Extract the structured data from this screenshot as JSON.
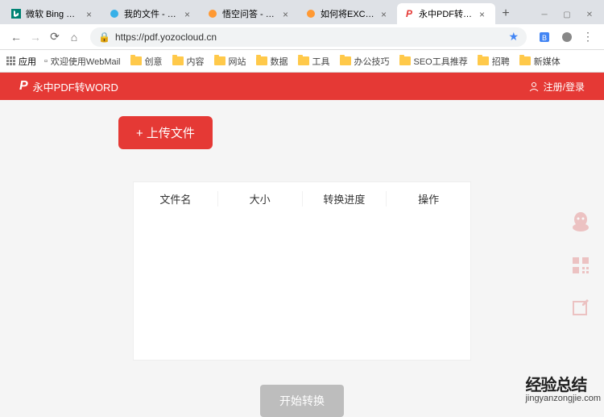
{
  "browser": {
    "tabs": [
      {
        "title": "微软 Bing 搜索 - 国",
        "icon": "bing"
      },
      {
        "title": "我的文件 - 优云",
        "icon": "cloud"
      },
      {
        "title": "悟空问答 - 搜索",
        "icon": "wukong"
      },
      {
        "title": "如何将EXCEL转换",
        "icon": "wukong"
      },
      {
        "title": "永中PDF转Word",
        "icon": "yozo",
        "active": true
      }
    ],
    "url": "https://pdf.yozocloud.cn",
    "apps_label": "应用",
    "bookmarks": [
      "欢迎使用WebMail",
      "创意",
      "内容",
      "网站",
      "数据",
      "工具",
      "办公技巧",
      "SEO工具推荐",
      "招聘",
      "新媒体"
    ]
  },
  "header": {
    "title": "永中PDF转WORD",
    "login": "注册/登录"
  },
  "main": {
    "upload_label": "+ 上传文件",
    "columns": [
      "文件名",
      "大小",
      "转换进度",
      "操作"
    ],
    "start_label": "开始转换"
  },
  "side": {
    "items": [
      "qq-icon",
      "qrcode-icon",
      "edit-icon"
    ]
  },
  "watermark": {
    "main": "经验总结",
    "sub": "jingyanzongjie.com"
  }
}
